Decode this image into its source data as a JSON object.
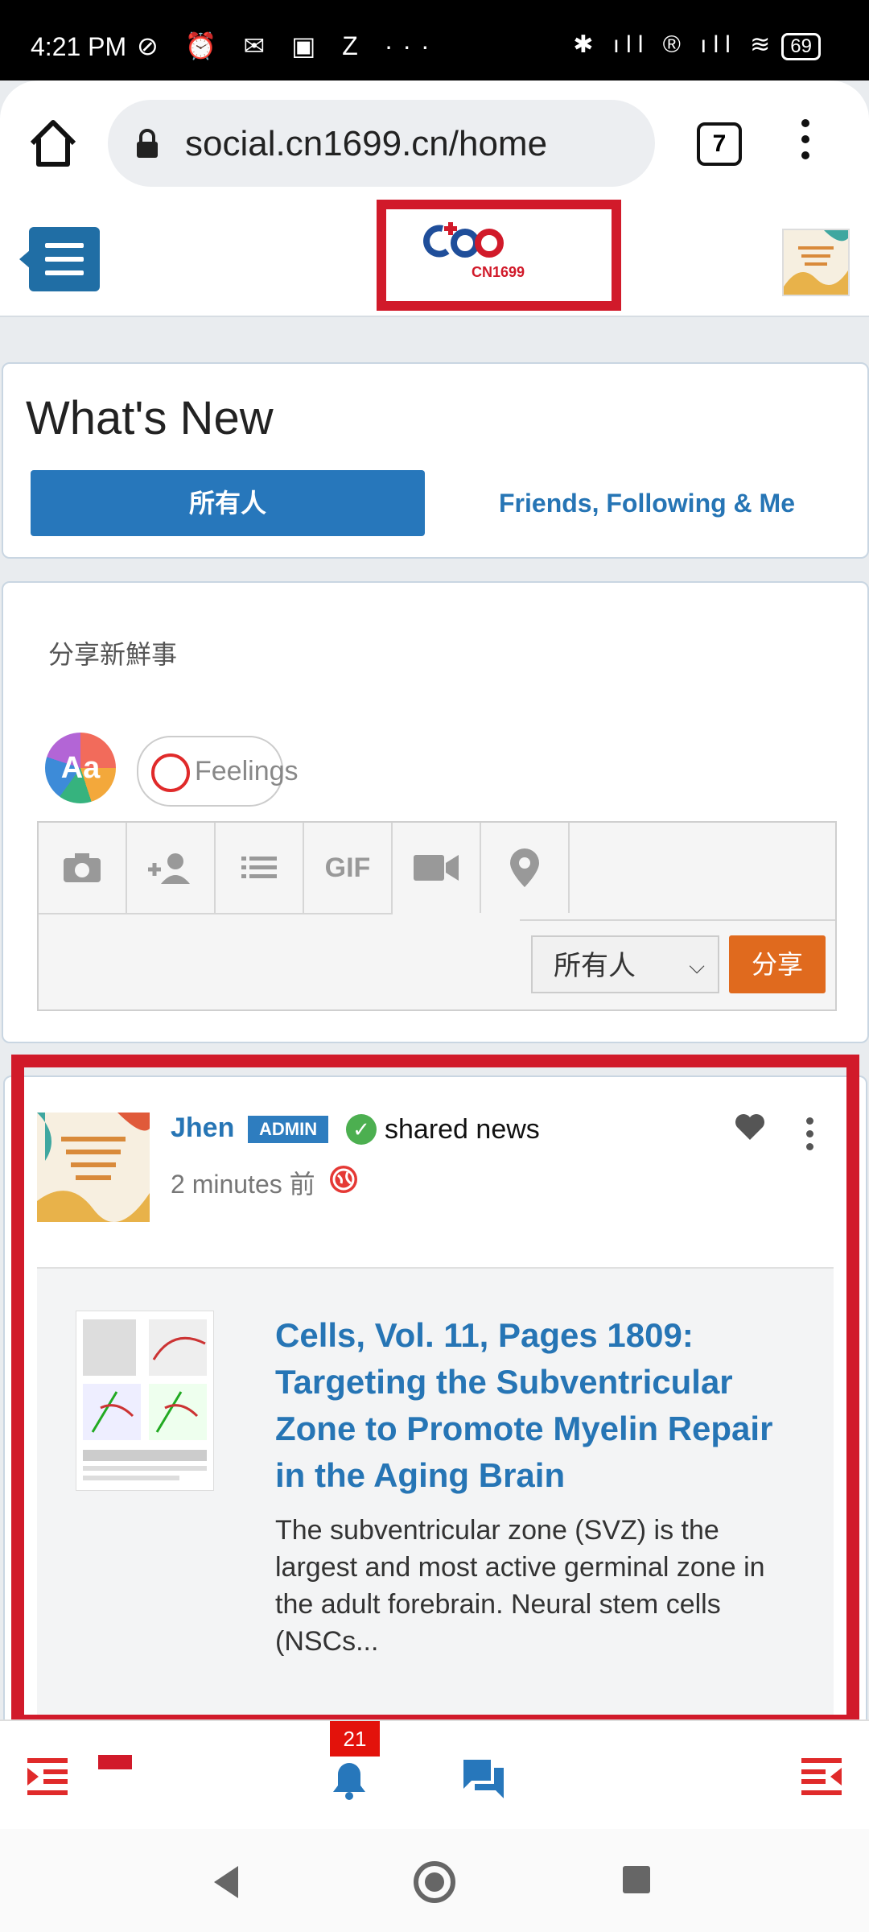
{
  "status_bar": {
    "time": "4:21 PM",
    "left_icons": "⊘ ⏰ ✉ ▣ Z ···",
    "right_icons": "✱ ıll ® ıll ≋",
    "battery": "69"
  },
  "browser": {
    "url": "social.cn1699.cn/home",
    "tab_count": "7"
  },
  "site": {
    "logo_text": "CN1699"
  },
  "whats_new": {
    "title": "What's New",
    "tab_all": "所有人",
    "tab_friends": "Friends, Following & Me"
  },
  "composer": {
    "placeholder": "分享新鮮事",
    "aa_label": "Aa",
    "feelings_label": "Feelings",
    "tools": [
      "camera-icon",
      "tag-friend-icon",
      "poll-list-icon",
      "gif-icon",
      "video-icon",
      "location-icon"
    ],
    "gif_label": "GIF",
    "privacy_value": "所有人",
    "share_label": "分享"
  },
  "post": {
    "author": "Jhen",
    "badge": "ADMIN",
    "action": "shared news",
    "time_ago": "2 minutes 前",
    "news_title": "Cells, Vol. 11, Pages 1809: Targeting the Subventricular Zone to Promote Myelin Repair in the Aging Brain",
    "news_excerpt": "The subventricular zone (SVZ) is the largest and most active germinal zone in the adult forebrain. Neural stem cells (NSCs..."
  },
  "bottom_bar": {
    "notification_count": "21"
  },
  "colors": {
    "brand_blue": "#2777bb",
    "link_blue": "#2675b5",
    "highlight_red": "#d11a2a",
    "share_orange": "#e06a1e"
  }
}
